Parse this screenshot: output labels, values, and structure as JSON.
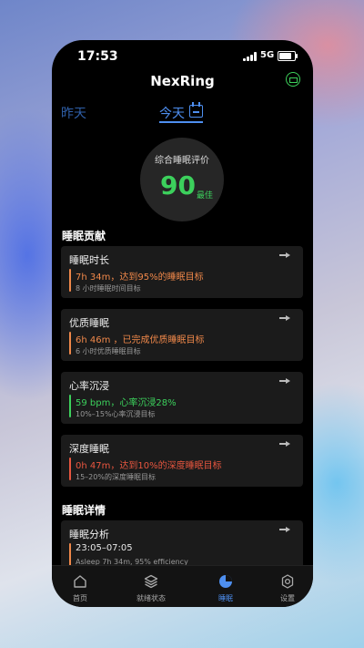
{
  "status_bar": {
    "time": "17:53",
    "network": "5G"
  },
  "header": {
    "title": "NexRing",
    "ring_icon": "ring-battery-icon"
  },
  "day_tabs": {
    "previous": "昨天",
    "current": "今天"
  },
  "score": {
    "label": "综合睡眠评价",
    "value": "90",
    "rating": "最佳"
  },
  "contributions": {
    "title": "睡眠贡献",
    "cards": [
      {
        "title": "睡眠时长",
        "main": "7h 34m，达到95%的睡眠目标",
        "sub": "8 小时睡眠时间目标",
        "color": "#f0884a"
      },
      {
        "title": "优质睡眠",
        "main": "6h 46m ，已完成优质睡眠目标",
        "sub": "6 小时优质睡眠目标",
        "color": "#f0884a"
      },
      {
        "title": "心率沉浸",
        "main": "59 bpm，心率沉浸28%",
        "sub": "10%–15%心率沉浸目标",
        "color": "#3cd05c"
      },
      {
        "title": "深度睡眠",
        "main": "0h 47m，达到10%的深度睡眠目标",
        "sub": "15–20%的深度睡眠目标",
        "color": "#e8563f"
      }
    ]
  },
  "details": {
    "title": "睡眠详情",
    "cards": [
      {
        "title": "睡眠分析",
        "main": "23:05–07:05",
        "sub": "Asleep 7h 34m, 95% efficiency",
        "color": "#f0884a"
      }
    ]
  },
  "tabbar": {
    "items": [
      {
        "label": "首页",
        "icon": "home-icon"
      },
      {
        "label": "就绪状态",
        "icon": "layers-icon"
      },
      {
        "label": "睡眠",
        "icon": "sleep-pie-icon"
      },
      {
        "label": "设置",
        "icon": "gear-icon"
      }
    ],
    "active": "睡眠"
  },
  "colors": {
    "accent": "#4e8ff0",
    "good": "#3cd05c",
    "warn": "#f0884a",
    "bad": "#e8563f"
  }
}
